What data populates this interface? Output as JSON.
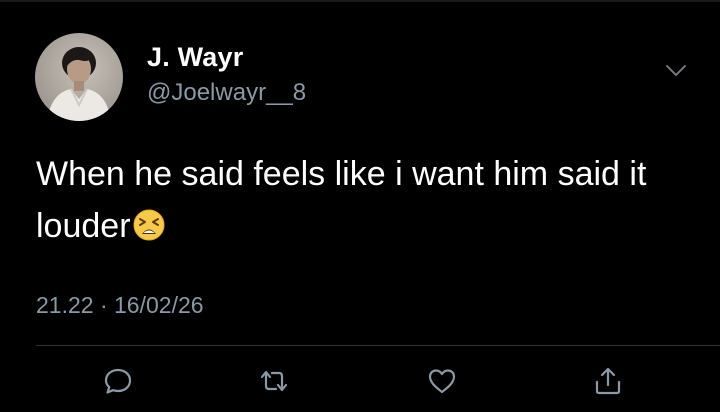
{
  "tweet": {
    "author": {
      "display_name": "J. Wayr",
      "handle": "@Joelwayr__8"
    },
    "text": "When he said feels like i want him said it louder",
    "emoji": "tired-face-emoji",
    "time": "21.22",
    "separator": "·",
    "date": "16/02/26"
  },
  "actions": [
    {
      "name": "reply",
      "icon": "reply-icon"
    },
    {
      "name": "retweet",
      "icon": "retweet-icon"
    },
    {
      "name": "like",
      "icon": "heart-icon"
    },
    {
      "name": "share",
      "icon": "share-icon"
    }
  ],
  "colors": {
    "background": "#000000",
    "primary_text": "#ffffff",
    "secondary_text": "#8b98a5",
    "divider": "#2f3336"
  }
}
